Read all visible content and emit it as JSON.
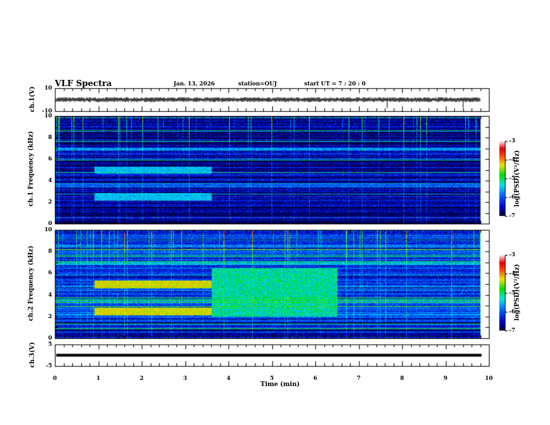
{
  "header": {
    "title": "VLF Spectra",
    "date": "Jan. 13, 2026",
    "station": "station=OUJ",
    "start": "start UT =  7 : 20 : 0"
  },
  "chart_data": [
    {
      "panel": "ch1-waveform",
      "type": "line",
      "ylabel": "ch.1(V)",
      "ylim": [
        -10,
        10
      ],
      "yticks": [
        "10",
        "-10"
      ],
      "xlim": [
        0,
        10
      ],
      "description_values": {
        "baseline_V": 0,
        "data_end_min": 9.8
      }
    },
    {
      "panel": "ch1-spectrogram",
      "type": "heatmap",
      "ylabel": "ch.1 Frequency (kHz)",
      "ylim": [
        0,
        10
      ],
      "yticks": [
        "0",
        "2",
        "4",
        "6",
        "8",
        "10"
      ],
      "xlim": [
        0,
        10
      ],
      "colorbar": {
        "label": "log(PSD)(V²/Hz)",
        "range": [
          -7,
          -3
        ],
        "ticks": [
          "-3",
          "-4",
          "-5",
          "-6",
          "-7"
        ]
      },
      "features": [
        {
          "freq_kHz": 5.0,
          "t_start_min": 0.9,
          "t_end_min": 3.6,
          "level": -5.5
        },
        {
          "freq_kHz": 2.5,
          "t_start_min": 0.9,
          "t_end_min": 3.6,
          "level": -5.5
        }
      ]
    },
    {
      "panel": "ch2-spectrogram",
      "type": "heatmap",
      "ylabel": "ch.2 Frequency (kHz)",
      "ylim": [
        0,
        10
      ],
      "yticks": [
        "0",
        "2",
        "4",
        "6",
        "8",
        "10"
      ],
      "xlim": [
        0,
        10
      ],
      "colorbar": {
        "label": "log(PSD)(V²/Hz)",
        "range": [
          -7,
          -3
        ],
        "ticks": [
          "-3",
          "-4",
          "-5",
          "-6",
          "-7"
        ]
      },
      "features": [
        {
          "freq_kHz": 5.0,
          "t_start_min": 0.9,
          "t_end_min": 3.6,
          "level": -4.3
        },
        {
          "freq_kHz": 2.5,
          "t_start_min": 0.9,
          "t_end_min": 3.6,
          "level": -4.3
        },
        {
          "freq_range_kHz": [
            2,
            6.5
          ],
          "t_start_min": 3.6,
          "t_end_min": 6.5,
          "level": -5.2
        }
      ]
    },
    {
      "panel": "ch3-waveform",
      "type": "line",
      "ylabel": "ch.3(V)",
      "ylim": [
        -5,
        5
      ],
      "yticks": [
        "5",
        "-5"
      ],
      "xlim": [
        0,
        10
      ],
      "description_values": {
        "baseline_V": 0,
        "data_end_min": 9.8
      }
    }
  ],
  "xaxis": {
    "label": "Time (min)",
    "ticks": [
      "0",
      "1",
      "2",
      "3",
      "4",
      "5",
      "6",
      "7",
      "8",
      "9",
      "10"
    ]
  }
}
